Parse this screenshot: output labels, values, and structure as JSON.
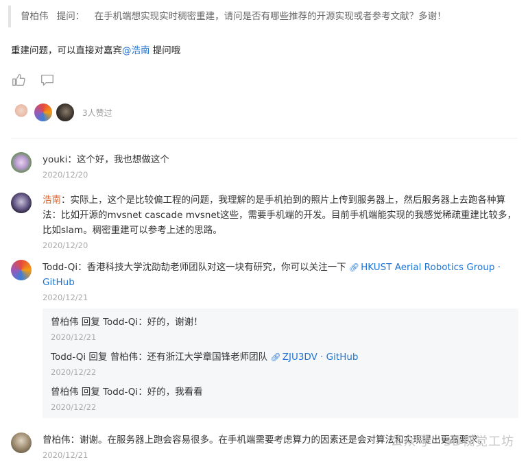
{
  "question": {
    "asker": "曾柏伟",
    "label": "提问：",
    "text": "在手机端想实现实时稠密重建，请问是否有哪些推荐的开源实现或者参考文献？多谢！"
  },
  "followup": {
    "prefix": "重建问题，可以直接对嘉宾",
    "mention": "@浩南",
    "suffix": " 提问哦"
  },
  "likes": {
    "count_text": "3人赞过"
  },
  "comments": [
    {
      "name": "youki",
      "text": "：这个好，我也想做这个",
      "date": "2020/12/20"
    },
    {
      "name": "浩南",
      "text": "：实际上，这个是比较偏工程的问题，我理解的是手机拍到的照片上传到服务器上，然后服务器上去跑各种算法：比如开源的mvsnet cascade mvsnet这些，需要手机端的开发。目前手机端能实现的我感觉稀疏重建比较多，比如slam。稠密重建可以参考上述的思路。",
      "date": "2020/12/20"
    },
    {
      "name": "Todd-Qi",
      "text": "：香港科技大学沈劭劼老师团队对这一块有研究，你可以关注一下",
      "link": "HKUST Aerial Robotics Group · GitHub",
      "date": "2020/12/21"
    },
    {
      "name": "曾柏伟",
      "text": "：谢谢。在服务器上跑会容易很多。在手机端需要考虑算力的因素还是会对算法和实现提出更高要求。",
      "date": "2020/12/21"
    }
  ],
  "replies": [
    {
      "from": "曾柏伟",
      "verb": " 回复 ",
      "to": "Todd-Qi",
      "text": "：好的，谢谢！",
      "date": "2020/12/21"
    },
    {
      "from": "Todd-Qi",
      "verb": " 回复 ",
      "to": "曾柏伟",
      "text": "：还有浙江大学章国锋老师团队",
      "link": "ZJU3DV · GitHub",
      "date": "2020/12/22"
    },
    {
      "from": "曾柏伟",
      "verb": " 回复 ",
      "to": "Todd-Qi",
      "text": "：好的，我看看",
      "date": "2020/12/22"
    }
  ],
  "watermark": "公众号 · 3D视觉工坊",
  "colors": {
    "mention": "#1e74d4",
    "author_highlight": "#d9622b",
    "meta": "#aaaaaa"
  }
}
